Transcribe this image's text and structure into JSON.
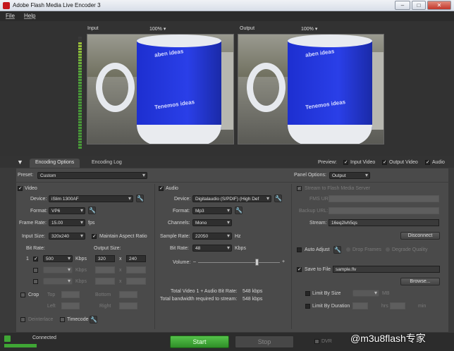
{
  "window": {
    "title": "Adobe Flash Media Live Encoder 3",
    "minimize": "–",
    "maximize": "□",
    "close": "✕"
  },
  "menu": {
    "file": "File",
    "help": "Help"
  },
  "preview": {
    "input_label": "Input",
    "input_zoom": "100%",
    "output_label": "Output",
    "output_zoom": "100%",
    "mug_text_top": "aben ideas",
    "mug_text_main": "Tenemos ideas"
  },
  "tabs": {
    "encoding_options": "Encoding Options",
    "encoding_log": "Encoding Log"
  },
  "preview_opts": {
    "label": "Preview:",
    "input_video": "Input Video",
    "output_video": "Output Video",
    "audio": "Audio"
  },
  "preset": {
    "label": "Preset:",
    "value": "Custom"
  },
  "panel_options": {
    "label": "Panel Options:",
    "value": "Output"
  },
  "video": {
    "title": "Video",
    "device_label": "Device:",
    "device": "iSlim 1300AF",
    "format_label": "Format:",
    "format": "VP6",
    "frame_rate_label": "Frame Rate:",
    "frame_rate": "15.00",
    "fps": "fps",
    "input_size_label": "Input Size:",
    "input_size": "320x240",
    "maintain_aspect": "Maintain Aspect Ratio",
    "bit_rate_label": "Bit Rate:",
    "output_size_label": "Output Size:",
    "row1_index": "1",
    "row1_bitrate": "500",
    "kbps": "Kbps",
    "out_w": "320",
    "out_h": "240",
    "x": "x",
    "crop": "Crop",
    "top": "Top",
    "bottom": "Bottom",
    "left": "Left",
    "right": "Right",
    "deinterlace": "Deinterlace",
    "timecode": "Timecode"
  },
  "audio": {
    "title": "Audio",
    "device_label": "Device:",
    "device": "Digitalaudio (S/PDIF) (High Def",
    "format_label": "Format:",
    "format": "Mp3",
    "channels_label": "Channels:",
    "channels": "Mono",
    "sample_rate_label": "Sample Rate:",
    "sample_rate": "22050",
    "hz": "Hz",
    "bit_rate_label": "Bit Rate:",
    "bit_rate": "48",
    "kbps": "Kbps",
    "volume_label": "Volume:",
    "volume_level": 0.72,
    "minus": "–",
    "plus": "+"
  },
  "totals": {
    "line1_label": "Total Video 1 + Audio Bit Rate:",
    "line1_value": "548 kbps",
    "line2_label": "Total bandwidth required to stream:",
    "line2_value": "548 kbps"
  },
  "stream": {
    "title": "Stream to Flash Media Server",
    "fms_url_label": "FMS URL:",
    "backup_url_label": "Backup URL:",
    "stream_label": "Stream:",
    "stream_value": "16eq2lvh5qs",
    "disconnect": "Disconnect",
    "auto_adjust": "Auto Adjust",
    "drop_frames": "Drop Frames",
    "degrade_quality": "Degrade Quality",
    "save_to_file": "Save to File",
    "file_name": "sample.flv",
    "browse": "Browse...",
    "limit_by_size": "Limit By Size",
    "mb": "MB",
    "limit_by_duration": "Limit By Duration",
    "hrs": "hrs",
    "min": "min"
  },
  "status": {
    "connected": "Connected",
    "start": "Start",
    "stop": "Stop",
    "dvr": "DVR"
  },
  "watermark": "@m3u8flash专家",
  "colors": {
    "accent_green": "#3fa635",
    "mug_blue": "#2a3fe8"
  }
}
